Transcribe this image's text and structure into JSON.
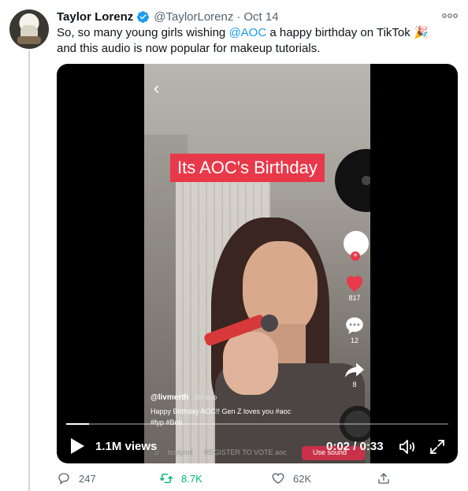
{
  "tweet": {
    "author_name": "Taylor Lorenz",
    "handle": "@TaylorLorenz",
    "separator": "·",
    "date": "Oct 14",
    "text_part1": "So, so many young girls wishing ",
    "mention": "@AOC",
    "text_part2": " a happy birthday on TikTok 🎉 and this audio is now popular for makeup tutorials."
  },
  "video": {
    "banner": "Its AOC's Birthday",
    "likes": "817",
    "comments": "12",
    "shares": "8",
    "username": "@livmerth",
    "posted": "· 8h ago",
    "caption": "Happy Birthday AOC!! Gen Z loves you #aoc",
    "hashtags": "#fyp #Boo",
    "sound_label": "bodyroll",
    "bottom_link": "REGISTER TO VOTE aoc",
    "use_sound": "Use sound",
    "view_count": "1.1M views",
    "time": "0:02 / 0:33",
    "progress": 0.06
  },
  "actions": {
    "replies": "247",
    "retweets": "8.7K",
    "likes": "62K"
  },
  "colors": {
    "accent": "#1d9bf0",
    "retweet": "#00ba7c",
    "muted": "#536471",
    "banner": "#e8394a"
  }
}
